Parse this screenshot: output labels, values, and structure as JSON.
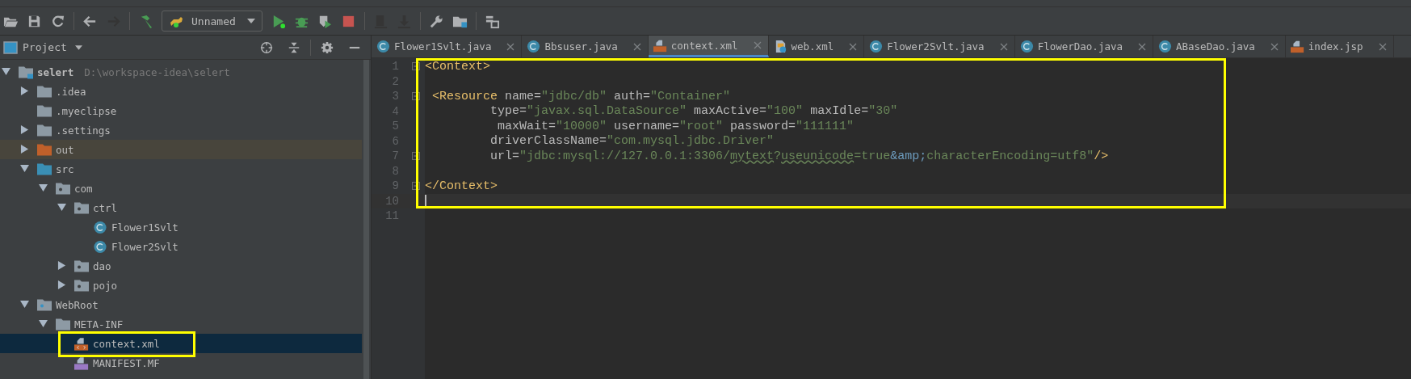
{
  "toolbar": {
    "items": [
      {
        "kind": "open",
        "disabled": false
      },
      {
        "kind": "save",
        "disabled": false
      },
      {
        "kind": "sync",
        "disabled": false
      },
      {
        "kind": "sep"
      },
      {
        "kind": "back",
        "disabled": false
      },
      {
        "kind": "forward",
        "disabled": true
      },
      {
        "kind": "sep"
      },
      {
        "kind": "build",
        "disabled": false
      },
      {
        "kind": "config",
        "label": "Unnamed"
      },
      {
        "kind": "run",
        "disabled": false
      },
      {
        "kind": "debug",
        "disabled": false
      },
      {
        "kind": "coverage",
        "disabled": false
      },
      {
        "kind": "stop",
        "disabled": false
      },
      {
        "kind": "sep"
      },
      {
        "kind": "deploy",
        "disabled": true
      },
      {
        "kind": "undeploy",
        "disabled": true
      },
      {
        "kind": "sep"
      },
      {
        "kind": "settings",
        "disabled": false
      },
      {
        "kind": "structure",
        "disabled": false
      },
      {
        "kind": "sep"
      },
      {
        "kind": "tasks",
        "disabled": false
      }
    ]
  },
  "project_panel": {
    "title": "Project",
    "tree": [
      {
        "label": "selert",
        "path": "D:\\workspace-idea\\selert",
        "kind": "project",
        "expanded": true,
        "selected": false,
        "children": [
          {
            "label": ".idea",
            "kind": "folder",
            "expanded": false,
            "selected": false
          },
          {
            "label": ".myeclipse",
            "kind": "folder",
            "selected": false
          },
          {
            "label": ".settings",
            "kind": "folder",
            "expanded": false,
            "selected": false
          },
          {
            "label": "out",
            "kind": "excluded",
            "expanded": false,
            "selected": false
          },
          {
            "label": "src",
            "kind": "source",
            "expanded": true,
            "selected": false,
            "children": [
              {
                "label": "com",
                "kind": "package",
                "expanded": true,
                "selected": false,
                "children": [
                  {
                    "label": "ctrl",
                    "kind": "package",
                    "expanded": true,
                    "selected": false,
                    "children": [
                      {
                        "label": "Flower1Svlt",
                        "kind": "class",
                        "selected": false
                      },
                      {
                        "label": "Flower2Svlt",
                        "kind": "class",
                        "selected": false
                      }
                    ]
                  },
                  {
                    "label": "dao",
                    "kind": "package",
                    "expanded": false,
                    "selected": false
                  },
                  {
                    "label": "pojo",
                    "kind": "package",
                    "expanded": false,
                    "selected": false
                  }
                ]
              }
            ]
          },
          {
            "label": "WebRoot",
            "kind": "web",
            "expanded": true,
            "selected": false,
            "children": [
              {
                "label": "META-INF",
                "kind": "folder",
                "expanded": true,
                "selected": false,
                "children": [
                  {
                    "label": "context.xml",
                    "kind": "xml",
                    "selected": true
                  },
                  {
                    "label": "MANIFEST.MF",
                    "kind": "mf",
                    "selected": false
                  }
                ]
              }
            ]
          }
        ]
      }
    ]
  },
  "tabs": [
    {
      "label": "Flower1Svlt.java",
      "kind": "class",
      "selected": false
    },
    {
      "label": "Bbsuser.java",
      "kind": "class",
      "selected": false
    },
    {
      "label": "context.xml",
      "kind": "xml",
      "selected": true
    },
    {
      "label": "web.xml",
      "kind": "web",
      "selected": false
    },
    {
      "label": "Flower2Svlt.java",
      "kind": "class",
      "selected": false
    },
    {
      "label": "FlowerDao.java",
      "kind": "class",
      "selected": false
    },
    {
      "label": "ABaseDao.java",
      "kind": "class",
      "selected": false
    },
    {
      "label": "index.jsp",
      "kind": "jsp",
      "selected": false
    }
  ],
  "editor": {
    "lines": [
      {
        "number": "1",
        "fold": true,
        "current": false,
        "tokens": [
          {
            "kind": "tag",
            "text": "<Context>"
          }
        ]
      },
      {
        "number": "2",
        "fold": false,
        "current": false
      },
      {
        "number": "3",
        "fold": true,
        "current": false,
        "tokens": [
          {
            "kind": "tag",
            "text": " <Resource"
          },
          {
            "kind": "attr",
            "text": " name="
          },
          {
            "kind": "value",
            "text": "\"jdbc/db\""
          },
          {
            "kind": "attr",
            "text": " auth="
          },
          {
            "kind": "value",
            "text": "\"Container\""
          }
        ]
      },
      {
        "number": "4",
        "fold": false,
        "current": false,
        "tokens": [
          {
            "kind": "attr",
            "text": "         type="
          },
          {
            "kind": "value",
            "text": "\"javax.sql.DataSource\""
          },
          {
            "kind": "attr",
            "text": " maxActive="
          },
          {
            "kind": "value",
            "text": "\"100\""
          },
          {
            "kind": "attr",
            "text": " maxIdle="
          },
          {
            "kind": "value",
            "text": "\"30\""
          }
        ]
      },
      {
        "number": "5",
        "fold": false,
        "current": false,
        "tokens": [
          {
            "kind": "attr",
            "text": "          maxWait="
          },
          {
            "kind": "value",
            "text": "\"10000\""
          },
          {
            "kind": "attr",
            "text": " username="
          },
          {
            "kind": "value",
            "text": "\"root\""
          },
          {
            "kind": "attr",
            "text": " password="
          },
          {
            "kind": "value",
            "text": "\"111111\""
          }
        ]
      },
      {
        "number": "6",
        "fold": false,
        "current": false,
        "tokens": [
          {
            "kind": "attr",
            "text": "         driverClassName="
          },
          {
            "kind": "value",
            "text": "\"com.mysql.jdbc.Driver\""
          }
        ]
      },
      {
        "number": "7",
        "fold": true,
        "current": false,
        "tokens": [
          {
            "kind": "attr",
            "text": "         url="
          },
          {
            "kind": "value",
            "text": "\"jdbc:mysql://127.0.0.1:3306/"
          },
          {
            "kind": "typo",
            "text": "mytext"
          },
          {
            "kind": "value",
            "text": "?"
          },
          {
            "kind": "typo",
            "text": "useunicode"
          },
          {
            "kind": "value",
            "text": "=true"
          },
          {
            "kind": "entity",
            "text": "&amp;"
          },
          {
            "kind": "value",
            "text": "characterEncoding=utf8\""
          },
          {
            "kind": "tag",
            "text": "/>"
          }
        ]
      },
      {
        "number": "8",
        "fold": false,
        "current": false
      },
      {
        "number": "9",
        "fold": true,
        "current": false,
        "tokens": [
          {
            "kind": "tag",
            "text": "</Context>"
          }
        ]
      },
      {
        "number": "10",
        "fold": false,
        "current": true
      },
      {
        "number": "11",
        "fold": false,
        "current": false
      }
    ]
  }
}
